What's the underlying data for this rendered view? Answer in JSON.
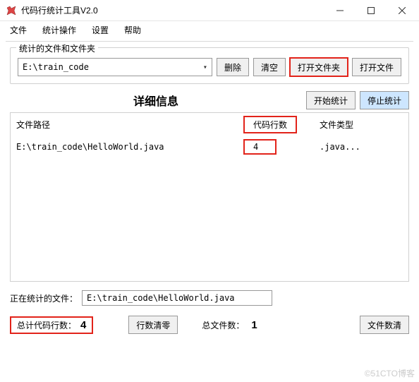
{
  "window": {
    "title": "代码行统计工具V2.0"
  },
  "menu": {
    "file": "文件",
    "statops": "统计操作",
    "settings": "设置",
    "help": "帮助"
  },
  "group": {
    "title": "统计的文件和文件夹",
    "path": "E:\\train_code"
  },
  "buttons": {
    "delete": "删除",
    "clear": "清空",
    "openFolder": "打开文件夹",
    "openFile": "打开文件",
    "start": "开始统计",
    "stop": "停止统计",
    "linesClear": "行数清零",
    "filesClear": "文件数清"
  },
  "detail": {
    "title": "详细信息",
    "cols": {
      "path": "文件路径",
      "lines": "代码行数",
      "type": "文件类型"
    },
    "row": {
      "path": "E:\\train_code\\HelloWorld.java",
      "lines": "4",
      "type": ".java..."
    }
  },
  "status": {
    "label": "正在统计的文件：",
    "value": "E:\\train_code\\HelloWorld.java"
  },
  "totals": {
    "linesLabel": "总计代码行数：",
    "lines": "4",
    "filesLabel": "总文件数：",
    "files": "1"
  },
  "watermark": "©51CTO博客"
}
